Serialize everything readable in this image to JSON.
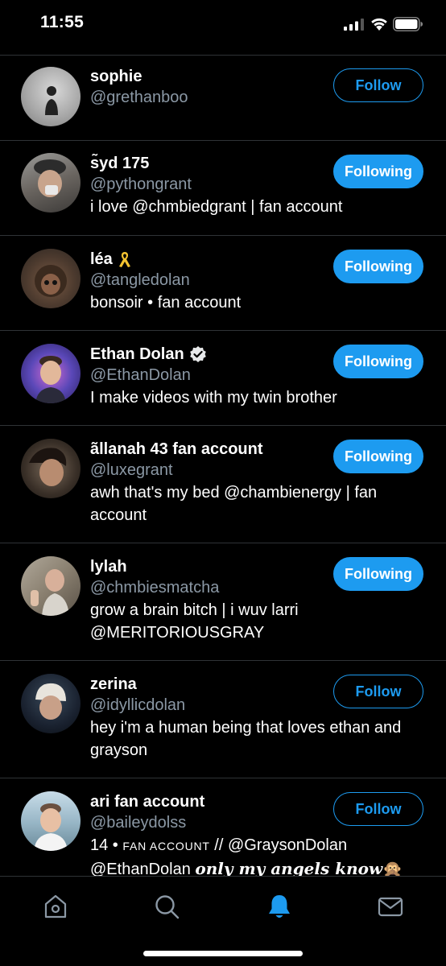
{
  "status_bar": {
    "time": "11:55"
  },
  "accounts": [
    {
      "name": "sophie",
      "name_suffix": "",
      "handle": "@grethanboo",
      "bio": "",
      "button": "Follow",
      "following": false,
      "avatar_color": "#b0b0b0"
    },
    {
      "name": "s̃yd 175",
      "name_suffix": "",
      "handle": "@pythongrant",
      "bio": "i love @chmbiedgrant | fan account",
      "button": "Following",
      "following": true,
      "avatar_color": "#6d6a66"
    },
    {
      "name": "léa",
      "name_suffix": "🎗",
      "handle": "@tangledolan",
      "bio": "bonsoir • fan account",
      "button": "Following",
      "following": true,
      "avatar_color": "#4a3b30"
    },
    {
      "name": "Ethan Dolan",
      "name_suffix": "",
      "handle": "@EthanDolan",
      "bio": "I make videos with my twin brother",
      "button": "Following",
      "following": true,
      "verified": true,
      "avatar_color": "#5d4aa0"
    },
    {
      "name": "ãllanah 43 fan account",
      "name_suffix": "",
      "handle": "@luxegrant",
      "bio": "awh that's my bed @chambienergy | fan account",
      "button": "Following",
      "following": true,
      "avatar_color": "#3a3028"
    },
    {
      "name": "lylah",
      "name_suffix": "",
      "handle": "@chmbiesmatcha",
      "bio": "grow a brain bitch | i wuv larri @MERITORIOUSGRAY",
      "button": "Following",
      "following": true,
      "avatar_color": "#8e8478"
    },
    {
      "name": "zerina",
      "name_suffix": "",
      "handle": "@idyllicdolan",
      "bio": "hey i'm a human being that loves ethan and grayson",
      "button": "Follow",
      "following": false,
      "avatar_color": "#2a3340"
    },
    {
      "name": "ari fan account",
      "name_suffix": "",
      "handle": "@baileydolss",
      "bio_part1": "14 • ",
      "bio_smallcaps": "FAN ACCOUNT",
      "bio_part2": " // @GraysonDolan",
      "bio_part3": "@EthanDolan ",
      "bio_gothic": "only my angels know",
      "bio_emoji": "🙊",
      "button": "Follow",
      "following": false,
      "avatar_color": "#8fb0c0"
    }
  ],
  "tabbar": {
    "items": [
      "home-icon",
      "search-icon",
      "notifications-icon",
      "messages-icon"
    ],
    "active": "notifications-icon"
  },
  "colors": {
    "accent": "#1d9bf0",
    "divider": "#2f3336",
    "handle": "#8b98a5"
  }
}
